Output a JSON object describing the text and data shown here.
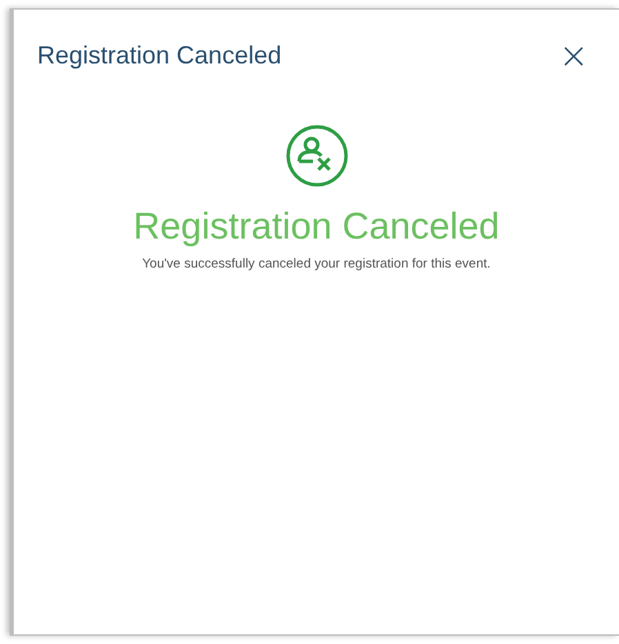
{
  "dialog": {
    "title": "Registration Canceled",
    "close": "×"
  },
  "message": {
    "heading": "Registration Canceled",
    "text": "You've successfully canceled your registration for this event."
  }
}
